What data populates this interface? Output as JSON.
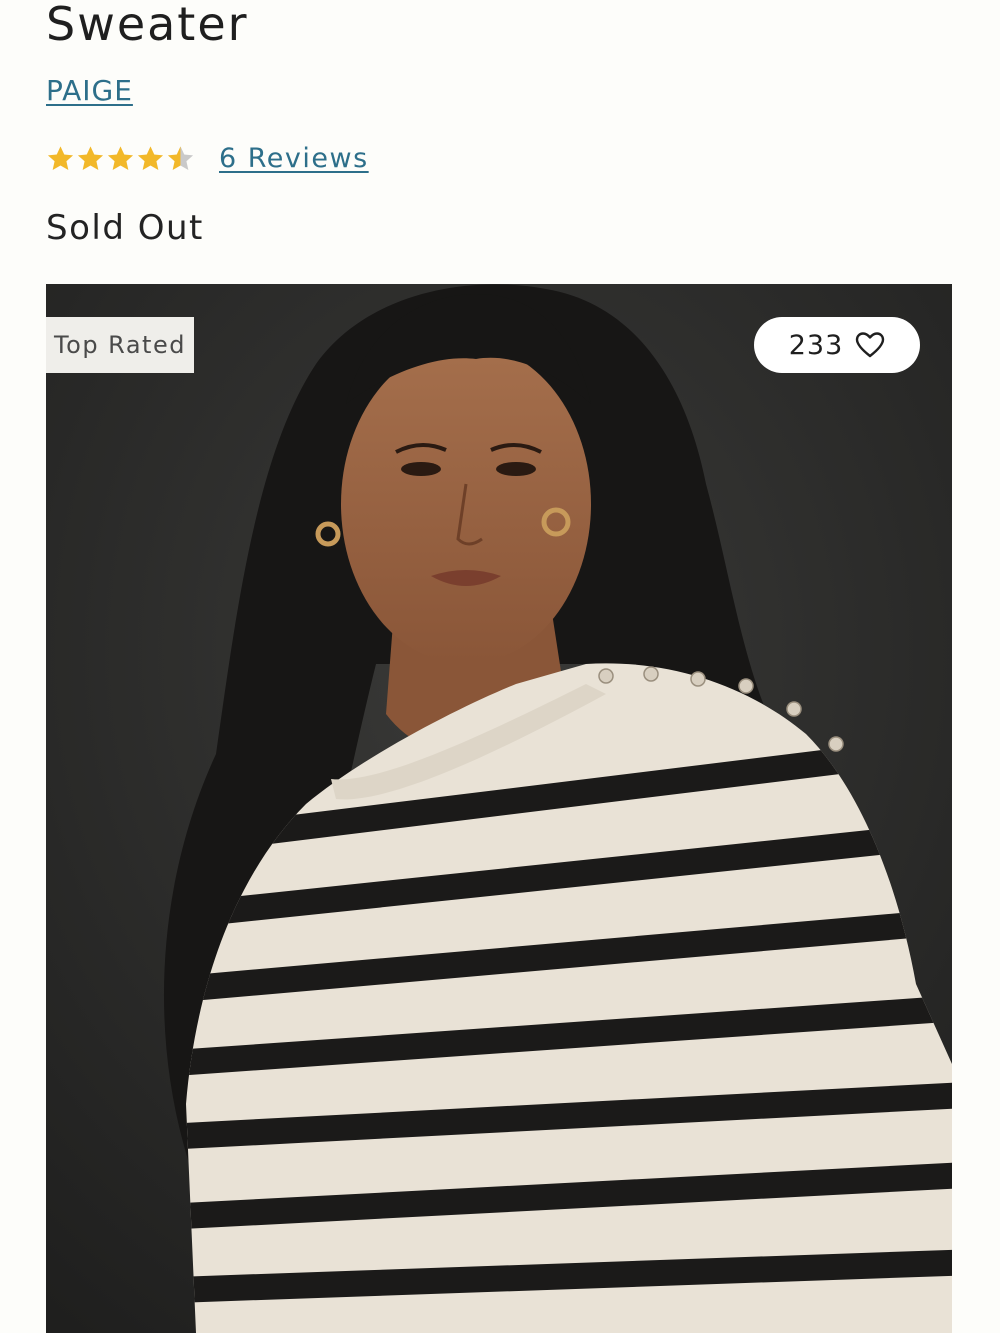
{
  "product": {
    "title": "Sweater",
    "brand": "PAIGE",
    "rating": {
      "value": 4.5,
      "max": 5,
      "reviews_label": "6 Reviews"
    },
    "status": "Sold Out"
  },
  "image": {
    "badge": "Top Rated",
    "likes": "233",
    "like_icon": "heart-outline-icon"
  },
  "colors": {
    "link": "#2d6f8a",
    "star_filled": "#f2b829",
    "star_empty": "#c9c9c9",
    "badge_bg": "#efeeea"
  }
}
